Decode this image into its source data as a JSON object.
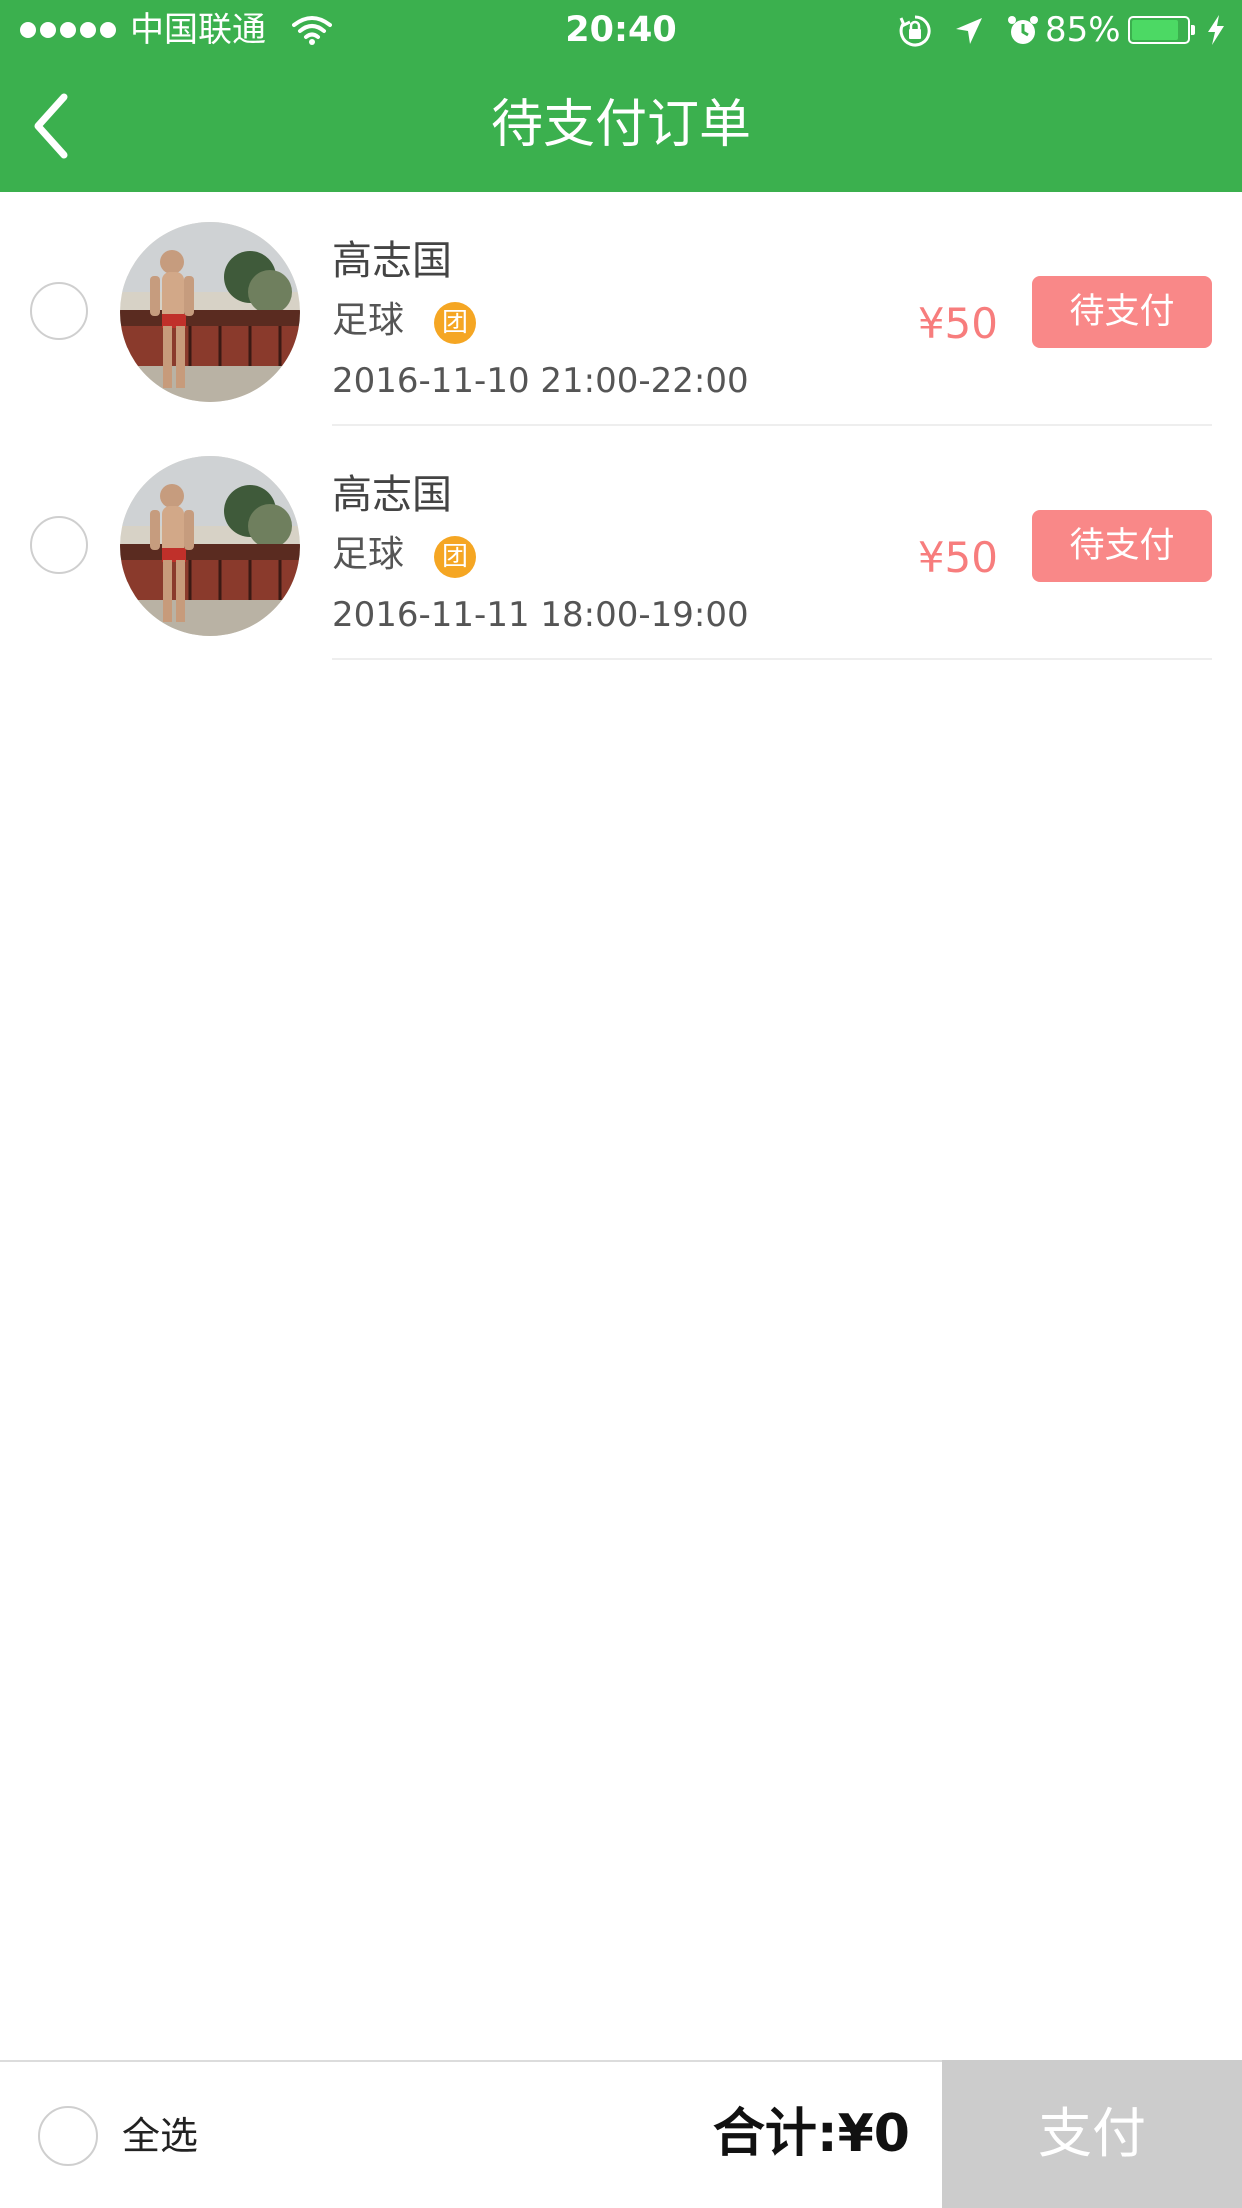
{
  "status_bar": {
    "carrier": "中国联通",
    "time": "20:40",
    "battery_percent": "85%",
    "battery_level": 0.85,
    "icons": [
      "signal-dots-icon",
      "wifi-icon",
      "orientation-lock-icon",
      "location-arrow-icon",
      "alarm-icon",
      "battery-icon",
      "charging-bolt-icon"
    ]
  },
  "nav": {
    "title": "待支付订单",
    "back_icon": "chevron-left-icon"
  },
  "orders": [
    {
      "name": "高志国",
      "sport": "足球",
      "group_badge": "团",
      "time": "2016-11-10 21:00-22:00",
      "price": "¥50",
      "status": "待支付",
      "selected": false
    },
    {
      "name": "高志国",
      "sport": "足球",
      "group_badge": "团",
      "time": "2016-11-11 18:00-19:00",
      "price": "¥50",
      "status": "待支付",
      "selected": false
    }
  ],
  "footer": {
    "select_all_label": "全选",
    "total_label": "合计:¥0",
    "pay_label": "支付"
  },
  "colors": {
    "brand_green": "#3bb04e",
    "price_red": "#f77d7d",
    "status_button": "#f98888",
    "group_badge": "#f5a623",
    "pay_disabled": "#cccccc"
  }
}
